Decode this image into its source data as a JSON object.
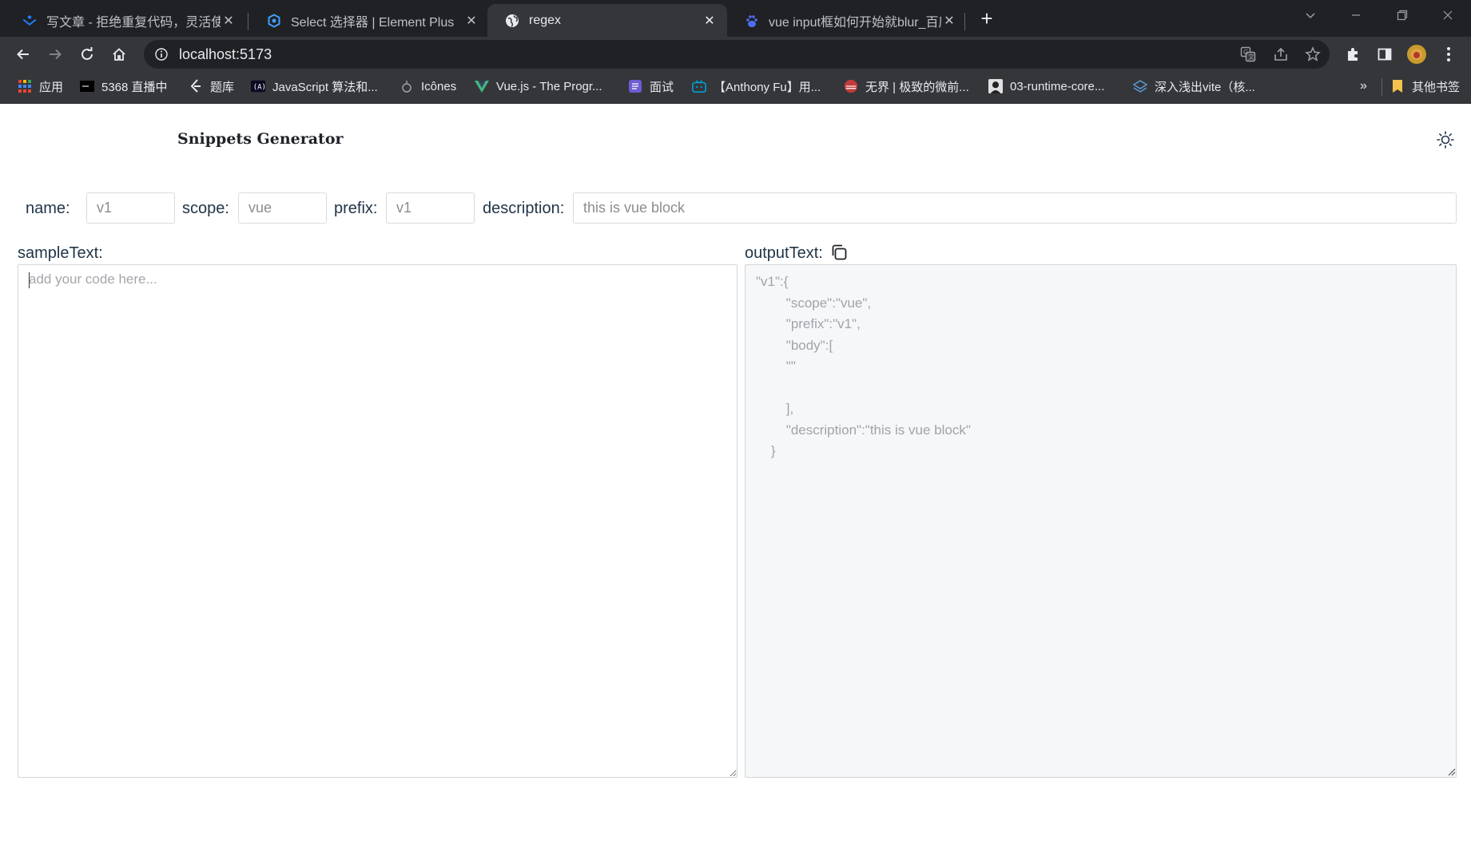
{
  "browser": {
    "tabs": [
      {
        "title": "写文章 - 拒绝重复代码，灵活使用",
        "favicon": "juejin-icon"
      },
      {
        "title": "Select 选择器 | Element Plus",
        "favicon": "element-plus-icon"
      },
      {
        "title": "regex",
        "favicon": "globe-icon",
        "active": true
      },
      {
        "title": "vue input框如何开始就blur_百度",
        "favicon": "baidu-icon"
      }
    ],
    "url": "localhost:5173",
    "bookmarks": [
      {
        "label": "应用",
        "icon": "apps-grid-icon"
      },
      {
        "label": "5368 直播中",
        "icon": "live-icon"
      },
      {
        "label": "题库",
        "icon": "leetcode-icon"
      },
      {
        "label": "JavaScript 算法和...",
        "icon": "fcc-icon"
      },
      {
        "label": "Icônes",
        "icon": "icones-icon"
      },
      {
        "label": "Vue.js - The Progr...",
        "icon": "vue-icon"
      },
      {
        "label": "面试",
        "icon": "notes-icon"
      },
      {
        "label": "【Anthony Fu】用...",
        "icon": "bilibili-icon"
      },
      {
        "label": "无界 | 极致的微前...",
        "icon": "wujie-icon"
      },
      {
        "label": "03-runtime-core...",
        "icon": "avatar-icon"
      },
      {
        "label": "深入浅出vite（核...",
        "icon": "layers-icon"
      }
    ],
    "other_bookmarks": "其他书签",
    "more_bookmarks": "»"
  },
  "app": {
    "title": "Snippets Generator",
    "fields": {
      "name_label": "name:",
      "name_value": "v1",
      "scope_label": "scope:",
      "scope_value": "vue",
      "prefix_label": "prefix:",
      "prefix_value": "v1",
      "description_label": "description:",
      "description_value": "this is vue block"
    },
    "sample_label": "sampleText:",
    "sample_placeholder": "add your code here...",
    "output_label": "outputText:",
    "output_text": "\"v1\":{\n        \"scope\":\"vue\",\n        \"prefix\":\"v1\",\n        \"body\":[\n        \"\"\n\n        ],\n        \"description\":\"this is vue block\"\n    }"
  },
  "colors": {
    "chrome_dark": "#202124",
    "chrome_toolbar": "#35363a",
    "text_primary": "#213547",
    "output_bg": "#f6f7f9"
  }
}
